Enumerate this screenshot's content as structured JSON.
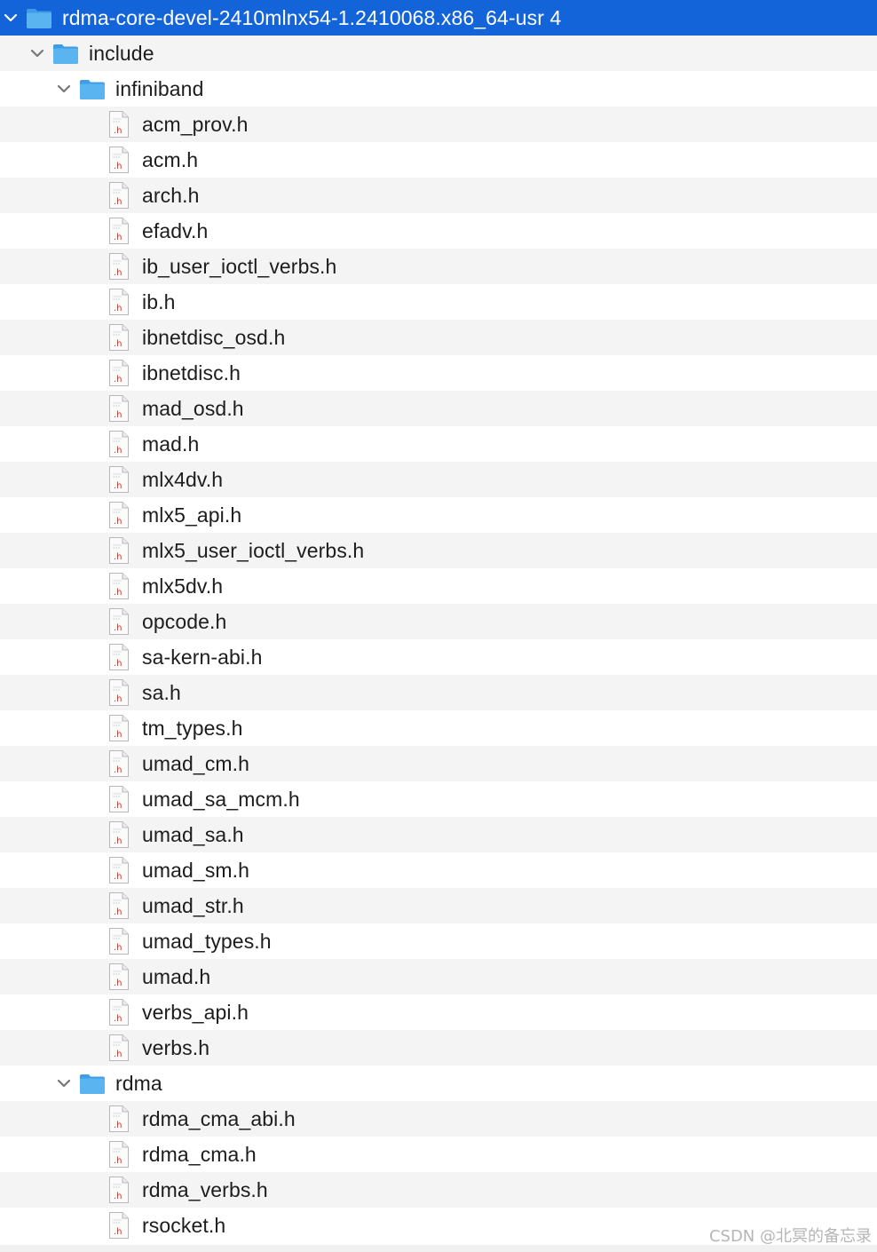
{
  "root": {
    "label": "rdma-core-devel-2410mlnx54-1.2410068.x86_64-usr 4",
    "icon": "folder-icon",
    "expanded": true,
    "selected": true
  },
  "colors": {
    "selection": "#1264d8",
    "folder": "#5ab4f0",
    "alt_row": "#f4f4f4",
    "file_ext": "#c0392b"
  },
  "folders": {
    "include": {
      "label": "include",
      "icon": "folder-icon",
      "expanded": true
    },
    "infiniband": {
      "label": "infiniband",
      "icon": "folder-icon",
      "expanded": true
    },
    "rdma": {
      "label": "rdma",
      "icon": "folder-icon",
      "expanded": true
    }
  },
  "infiniband_files": [
    "acm_prov.h",
    "acm.h",
    "arch.h",
    "efadv.h",
    "ib_user_ioctl_verbs.h",
    "ib.h",
    "ibnetdisc_osd.h",
    "ibnetdisc.h",
    "mad_osd.h",
    "mad.h",
    "mlx4dv.h",
    "mlx5_api.h",
    "mlx5_user_ioctl_verbs.h",
    "mlx5dv.h",
    "opcode.h",
    "sa-kern-abi.h",
    "sa.h",
    "tm_types.h",
    "umad_cm.h",
    "umad_sa_mcm.h",
    "umad_sa.h",
    "umad_sm.h",
    "umad_str.h",
    "umad_types.h",
    "umad.h",
    "verbs_api.h",
    "verbs.h"
  ],
  "rdma_files": [
    "rdma_cma_abi.h",
    "rdma_cma.h",
    "rdma_verbs.h",
    "rsocket.h"
  ],
  "file_icon": {
    "name": "header-file-icon",
    "ext_label": ".h"
  },
  "watermark": "CSDN @北冥的备忘录"
}
